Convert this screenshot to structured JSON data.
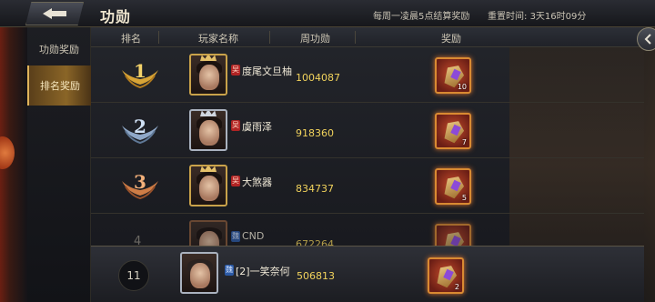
{
  "header": {
    "title": "功勋",
    "notice": "每周一凌晨5点结算奖励",
    "reset_label": "重置时间: ",
    "reset_time": "3天16时09分"
  },
  "sidebar": {
    "items": [
      {
        "label": "功勋奖励",
        "active": false
      },
      {
        "label": "排名奖励",
        "active": true
      }
    ]
  },
  "table": {
    "columns": [
      "排名",
      "玩家名称",
      "周功勋",
      "奖励"
    ],
    "rows": [
      {
        "rank": "1",
        "name": "度尾文旦柚",
        "faction": "吴",
        "score": "1004087",
        "reward_count": "10"
      },
      {
        "rank": "2",
        "name": "虞雨泽",
        "faction": "吴",
        "score": "918360",
        "reward_count": "7"
      },
      {
        "rank": "3",
        "name": "大煞器",
        "faction": "吴",
        "score": "834737",
        "reward_count": "5"
      },
      {
        "rank": "4",
        "name": "CND",
        "faction": "魏",
        "score": "672264",
        "reward_count": ""
      }
    ]
  },
  "my_rank": {
    "rank": "11",
    "faction": "魏",
    "name": "[2]一笑奈何",
    "score": "506813",
    "reward_count": "2"
  },
  "colors": {
    "gold": "#e5c16a",
    "score": "#f2d35c",
    "active_tab": "#8a6527"
  }
}
